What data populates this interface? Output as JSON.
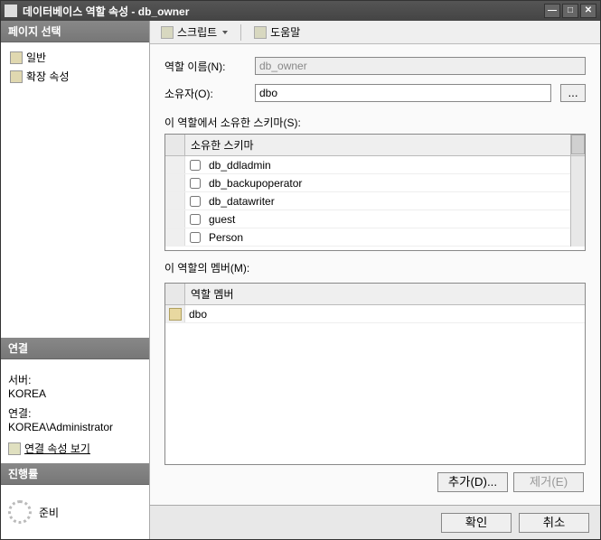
{
  "window": {
    "title": "데이터베이스 역할 속성 - db_owner"
  },
  "sidebar": {
    "pages_header": "페이지 선택",
    "pages": [
      {
        "label": "일반"
      },
      {
        "label": "확장 속성"
      }
    ],
    "connection_header": "연결",
    "server_label": "서버:",
    "server_value": "KOREA",
    "connection_label": "연결:",
    "connection_value": "KOREA\\Administrator",
    "view_conn_props": "연결 속성 보기",
    "progress_header": "진행률",
    "progress_status": "준비"
  },
  "toolbar": {
    "script_label": "스크립트",
    "help_label": "도움말"
  },
  "form": {
    "role_name_label": "역할 이름(N):",
    "role_name_value": "db_owner",
    "owner_label": "소유자(O):",
    "owner_value": "dbo",
    "browse": "...",
    "schemas_label": "이 역할에서 소유한 스키마(S):",
    "schemas_header": "소유한 스키마",
    "schemas": [
      {
        "name": "db_ddladmin",
        "checked": false
      },
      {
        "name": "db_backupoperator",
        "checked": false
      },
      {
        "name": "db_datawriter",
        "checked": false
      },
      {
        "name": "guest",
        "checked": false
      },
      {
        "name": "Person",
        "checked": false
      }
    ],
    "members_label": "이 역할의 멤버(M):",
    "members_header": "역할 멤버",
    "members": [
      {
        "name": "dbo"
      }
    ],
    "add_btn": "추가(D)...",
    "remove_btn": "제거(E)"
  },
  "footer": {
    "ok": "확인",
    "cancel": "취소"
  }
}
